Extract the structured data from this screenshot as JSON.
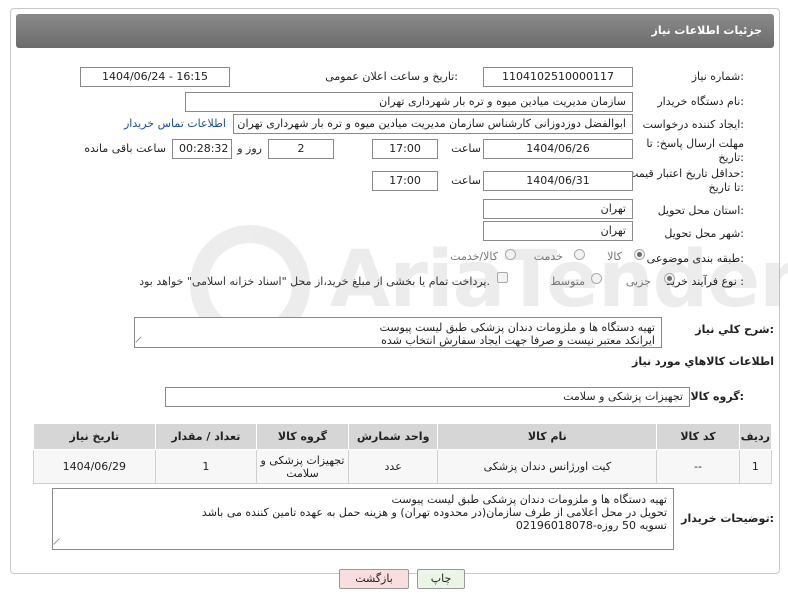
{
  "header": {
    "title": "جزئیات اطلاعات نیاز"
  },
  "fields": {
    "need_number": {
      "label": "شماره نیاز:",
      "value": "1104102510000117"
    },
    "announce_datetime": {
      "label": "تاریخ و ساعت اعلان عمومی:",
      "value": "1404/06/24 - 16:15"
    },
    "buyer_org": {
      "label": "نام دستگاه خریدار:",
      "value": "سازمان مدیریت میادین میوه و تره بار شهرداری تهران"
    },
    "requester": {
      "label": "ایجاد کننده درخواست:",
      "value": "ابوالفضل دوزدوزانی کارشناس سازمان مدیریت میادین میوه و تره بار شهرداری تهران",
      "contact_link": "اطلاعات تماس خریدار"
    },
    "reply_deadline": {
      "label_line1": "مهلت ارسال پاسخ: تا",
      "label_line2": "تاریخ:",
      "date": "1404/06/26",
      "time_label": "ساعت",
      "time": "17:00",
      "days": "2",
      "days_label": "روز و",
      "remaining": "00:28:32",
      "remaining_label": "ساعت باقی مانده"
    },
    "price_validity": {
      "label_line1": "حداقل تاریخ اعتبار قیمت:",
      "label_line2": "تا تاریخ:",
      "date": "1404/06/31",
      "time_label": "ساعت",
      "time": "17:00"
    },
    "delivery_province": {
      "label": "استان محل تحویل:",
      "value": "تهران"
    },
    "delivery_city": {
      "label": "شهر محل تحویل:",
      "value": "تهران"
    },
    "category": {
      "label": "طبقه بندی موضوعی:",
      "options": [
        "کالا",
        "خدمت",
        "کالا/خدمت"
      ],
      "selected": 0
    },
    "process_type": {
      "label": "نوع فرآیند خرید :",
      "options": [
        "جزیی",
        "متوسط"
      ],
      "selected": 0,
      "note": "پرداخت تمام یا بخشی از مبلغ خرید،از محل \"اسناد خزانه اسلامی\" خواهد بود."
    }
  },
  "description": {
    "label": "شرح کلي نياز:",
    "lines": [
      "تهیه دستگاه ها و ملزومات دندان پزشکی طبق لیست پیوست",
      "ایرانکد معتبر نیست و صرفا جهت ایجاد سفارش انتخاب شده"
    ]
  },
  "goods_section": {
    "title": "اطلاعات کالاهاي مورد نياز"
  },
  "goods_group": {
    "label": "گروه کالا:",
    "value": "تجهیزات پزشکی و سلامت"
  },
  "table": {
    "headers": [
      "ردیف",
      "کد کالا",
      "نام کالا",
      "واحد شمارش",
      "گروه کالا",
      "تعداد / مقدار",
      "تاریخ نیاز"
    ],
    "rows": [
      [
        "1",
        "--",
        "کیت اورژانس دندان پزشکی",
        "عدد",
        "تجهیزات پزشکی و سلامت",
        "1",
        "1404/06/29"
      ]
    ]
  },
  "buyer_notes": {
    "label": "توضیحات خریدار:",
    "lines": [
      "تهیه دستگاه ها و ملزومات دندان پزشکی طبق لیست پیوست",
      "تحویل در محل اعلامی از طرف سازمان(در محدوده تهران) و هزینه حمل به عهده تامین کننده می باشد",
      "تسویه 50 روزه-02196018078"
    ]
  },
  "buttons": {
    "print": "چاپ",
    "back": "بازگشت"
  },
  "watermark": {
    "text": "AriaTender.net"
  },
  "colors": {
    "header_bg": "#7b7b7b",
    "link": "#1a4fa3",
    "back_button": "#f8dede",
    "print_button": "#eaf5e6"
  }
}
